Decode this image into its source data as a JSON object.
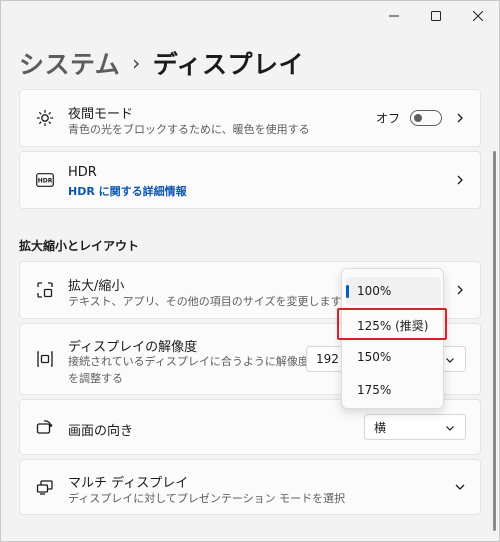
{
  "window": {
    "controls": {
      "minimize": "minimize",
      "maximize": "maximize",
      "close": "close"
    }
  },
  "breadcrumb": {
    "parent": "システム",
    "separator": "›",
    "current": "ディスプレイ"
  },
  "night_light": {
    "title": "夜間モード",
    "desc": "青色の光をブロックするために、暖色を使用する",
    "state_label": "オフ",
    "toggle_on": false,
    "icon": "brightness-icon"
  },
  "hdr": {
    "title": "HDR",
    "link": "HDR に関する詳細情報",
    "icon": "hdr-icon"
  },
  "section": {
    "title": "拡大縮小とレイアウト"
  },
  "scale": {
    "title": "拡大/縮小",
    "desc": "テキスト、アプリ、その他の項目のサイズを変更します",
    "icon": "scale-icon"
  },
  "resolution": {
    "title": "ディスプレイの解像度",
    "desc_line1": "接続されているディスプレイに合うように解像度",
    "desc_line2": "を調整する",
    "value_partial": "192",
    "icon": "resolution-icon"
  },
  "orientation": {
    "title": "画面の向き",
    "value": "横",
    "icon": "orientation-icon"
  },
  "multi": {
    "title": "マルチ ディスプレイ",
    "desc": "ディスプレイに対してプレゼンテーション モードを選択",
    "icon": "multi-display-icon"
  },
  "scale_dropdown": {
    "options": [
      "100%",
      "125% (推奨)",
      "150%",
      "175%"
    ],
    "selected_index": 0,
    "highlighted_index": 1
  },
  "colors": {
    "accent": "#005fb8",
    "link": "#0f56b3",
    "highlight": "#d6232a"
  }
}
